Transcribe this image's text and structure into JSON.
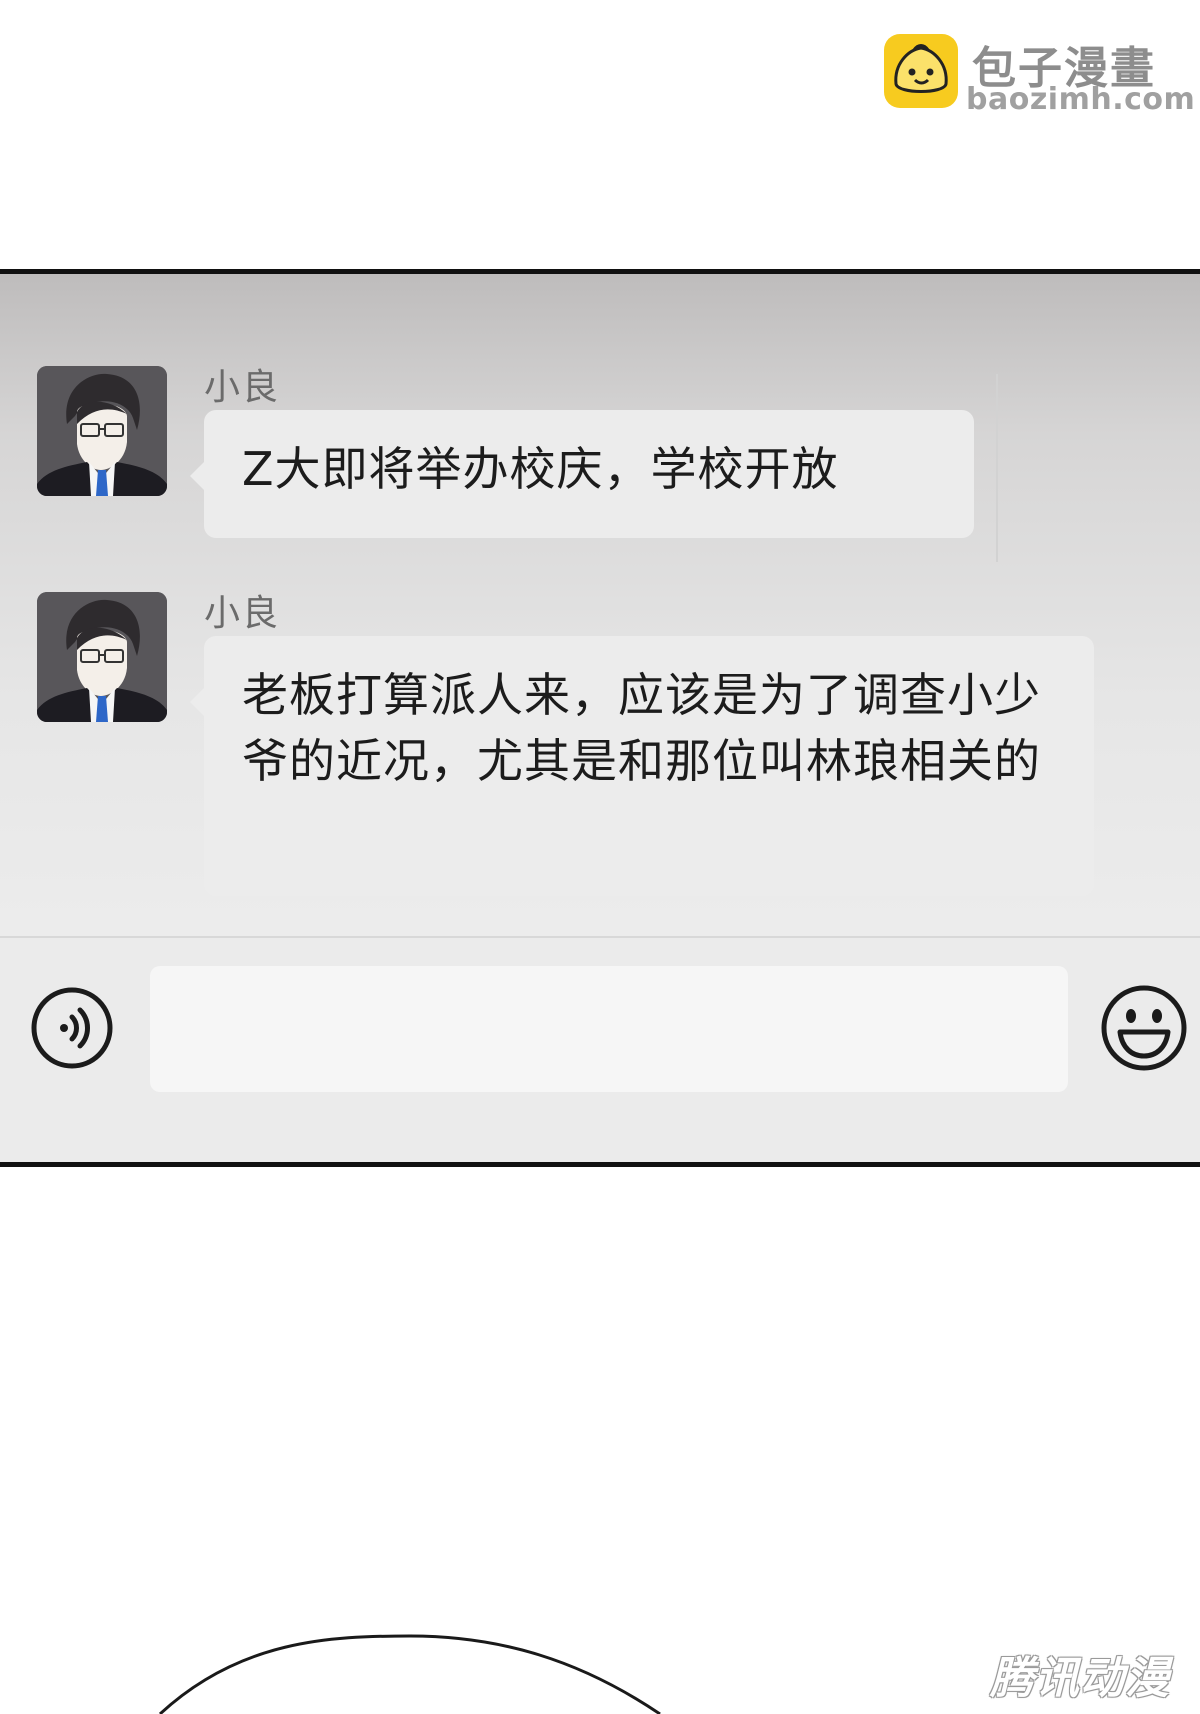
{
  "watermark_top": {
    "title": "包子漫畫",
    "url": "baozimh.com"
  },
  "chat": {
    "messages": [
      {
        "sender": "小良",
        "text": "Z大即将举办校庆，学校开放"
      },
      {
        "sender": "小良",
        "text": "老板打算派人来，应该是为了调查小少爷的近况，尤其是和那位叫林琅相关的"
      }
    ]
  },
  "input_bar": {
    "voice_icon": "voice-icon",
    "emoji_icon": "emoji-icon",
    "value": ""
  },
  "watermark_bottom": {
    "text": "腾讯动漫"
  },
  "colors": {
    "panel_top": "#bebcbc",
    "panel_bottom": "#ececec",
    "bubble": "#ececec",
    "logo": "#f7cb1f"
  }
}
